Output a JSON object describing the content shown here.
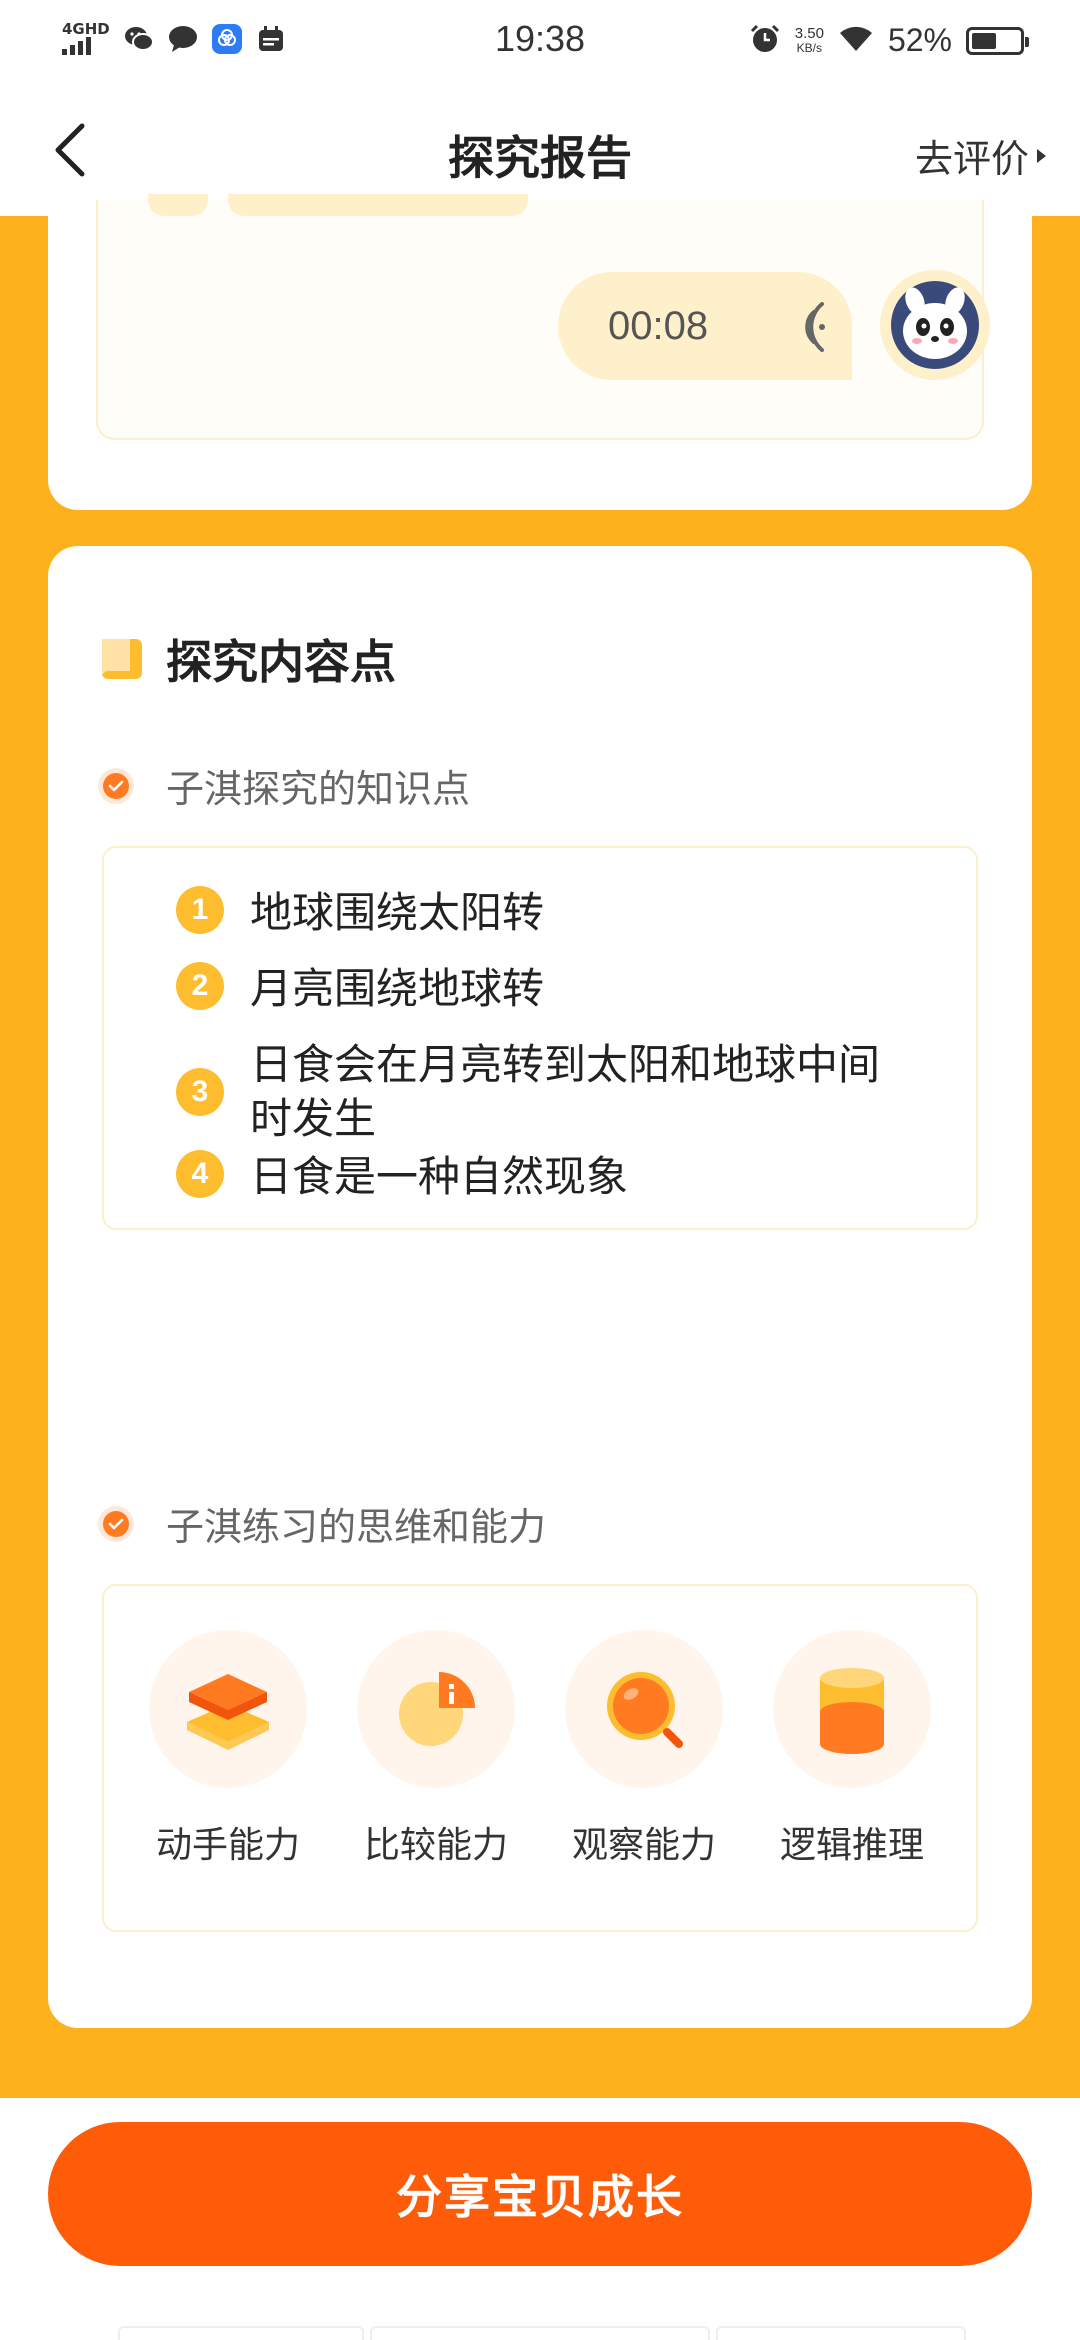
{
  "status_bar": {
    "network": "4GHD",
    "time": "19:38",
    "speed_value": "3.50",
    "speed_unit": "KB/s",
    "battery": "52%",
    "battery_level": 0.52
  },
  "nav": {
    "title": "探究报告",
    "action_label": "去评价"
  },
  "voice_message": {
    "duration": "00:08"
  },
  "section": {
    "title": "探究内容点",
    "knowledge_heading": "子淇探究的知识点",
    "knowledge_points": [
      {
        "num": "1",
        "text": "地球围绕太阳转"
      },
      {
        "num": "2",
        "text": "月亮围绕地球转"
      },
      {
        "num": "3",
        "text": "日食会在月亮转到太阳和地球中间时发生"
      },
      {
        "num": "4",
        "text": "日食是一种自然现象"
      }
    ],
    "ability_heading": "子淇练习的思维和能力",
    "abilities": [
      {
        "label": "动手能力",
        "icon": "hands-on-icon"
      },
      {
        "label": "比较能力",
        "icon": "comparison-icon"
      },
      {
        "label": "观察能力",
        "icon": "observation-icon"
      },
      {
        "label": "逻辑推理",
        "icon": "logic-icon"
      }
    ]
  },
  "footer": {
    "share_label": "分享宝贝成长"
  },
  "colors": {
    "background": "#FDB11C",
    "accent": "#FF5C0A",
    "number_badge": "#FDBD2E"
  }
}
